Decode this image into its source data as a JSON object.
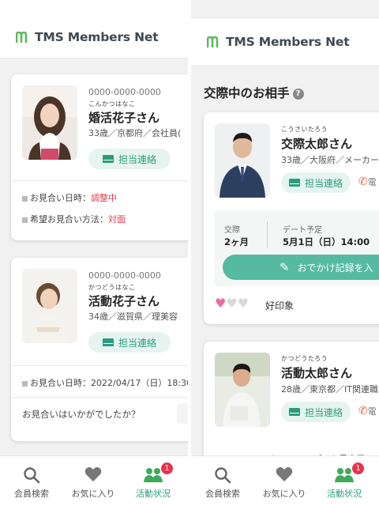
{
  "app": {
    "logo_text": "TMS Members Net",
    "brand_color": "#2a9c7c",
    "accent_red": "#e03b4a"
  },
  "left_panel": {
    "cards": [
      {
        "phone": "0000-0000-0000",
        "kana": "こんかつはなこ",
        "name": "婚活花子さん",
        "meta": "33歳／京都府／会社員(",
        "contact_label": "担当連絡",
        "info": [
          {
            "label": "お見合い日時：",
            "value": "調整中"
          },
          {
            "label": "希望お見合い方法：",
            "value": "対面"
          }
        ]
      },
      {
        "phone": "0000-0000-0000",
        "kana": "かつどうはなこ",
        "name": "活動花子さん",
        "meta": "34歳／滋賀県／理美容",
        "contact_label": "担当連絡",
        "info_datetime": "お見合い日時：2022/04/17（日）18:30",
        "question": "お見合いはいかがでしたか？"
      }
    ]
  },
  "right_panel": {
    "section_title": "交際中のお相手",
    "help_icon_label": "?",
    "cards": [
      {
        "kana": "こうさいたろう",
        "name": "交際太郎さん",
        "meta": "33歳／大阪府／メーカー",
        "contact_label": "担当連絡",
        "call_label": "電",
        "stats": {
          "period_label": "交際",
          "period_value": "2ヶ月",
          "date_label": "デート予定",
          "date_value": "5月1日（日）14:00"
        },
        "record_button": "おでかけ記録を入",
        "rating": {
          "value": 1,
          "max": 3
        },
        "impression": "好印象",
        "more": "›"
      },
      {
        "kana": "かつどうたろう",
        "name": "活動太郎さん",
        "meta": "28歳／東京都／IT関連職",
        "contact_label": "担当連絡",
        "call_label": "電",
        "peek_text": "ファーストコールでデート予定日"
      }
    ]
  },
  "tabbar": {
    "tabs": [
      {
        "label": "会員検索",
        "icon": "search-icon"
      },
      {
        "label": "お気に入り",
        "icon": "heart-icon"
      },
      {
        "label": "活動状況",
        "icon": "people-icon",
        "badge": "1",
        "active": true
      }
    ]
  }
}
